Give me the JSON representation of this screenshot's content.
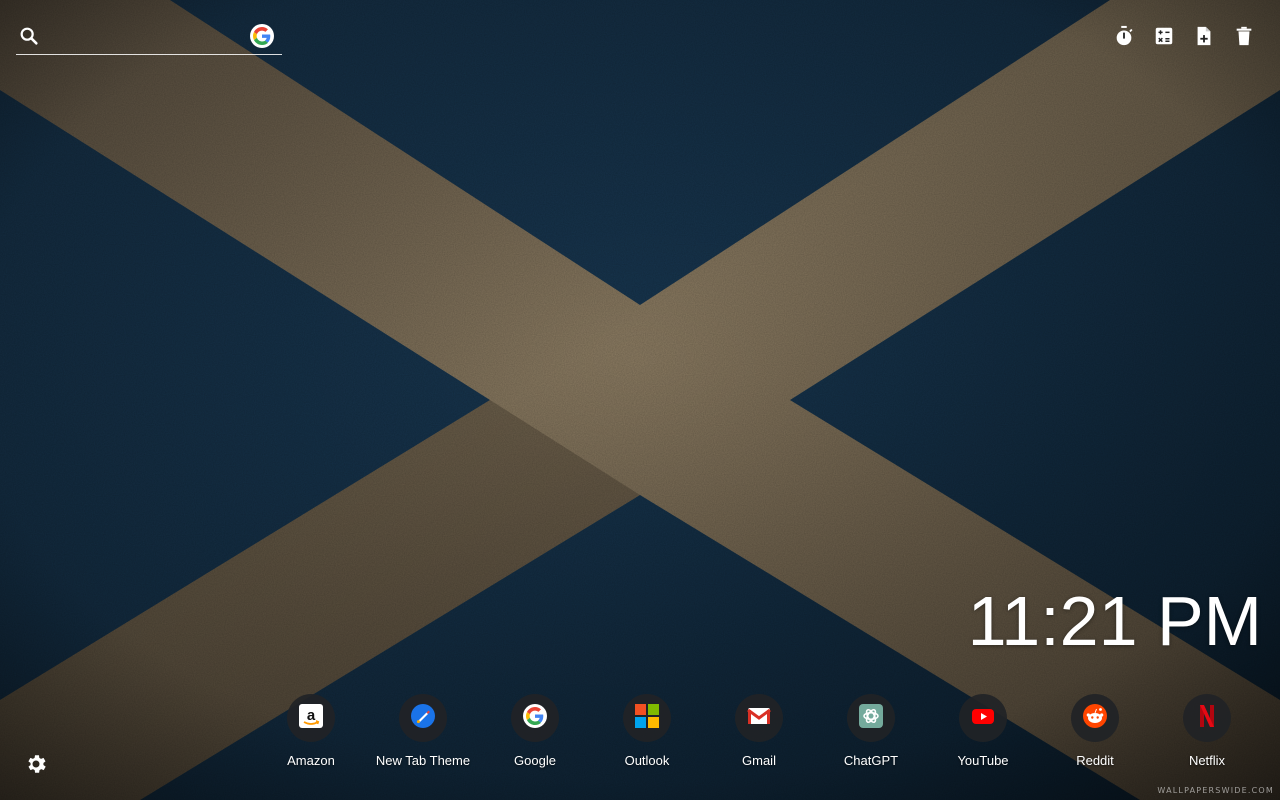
{
  "search": {
    "placeholder": "",
    "value": "",
    "engine_icon": "google-g-icon"
  },
  "toolbar": {
    "items": [
      {
        "name": "timer-button",
        "icon": "stopwatch-icon"
      },
      {
        "name": "calculator-button",
        "icon": "calculator-icon"
      },
      {
        "name": "new-note-button",
        "icon": "note-add-icon"
      },
      {
        "name": "delete-button",
        "icon": "trash-icon"
      }
    ]
  },
  "clock": {
    "time": "11:21 PM"
  },
  "shortcuts": [
    {
      "label": "Amazon",
      "icon": "amazon-icon"
    },
    {
      "label": "New Tab Theme",
      "icon": "new-tab-theme-icon"
    },
    {
      "label": "Google",
      "icon": "google-icon"
    },
    {
      "label": "Outlook",
      "icon": "outlook-icon"
    },
    {
      "label": "Gmail",
      "icon": "gmail-icon"
    },
    {
      "label": "ChatGPT",
      "icon": "chatgpt-icon"
    },
    {
      "label": "YouTube",
      "icon": "youtube-icon"
    },
    {
      "label": "Reddit",
      "icon": "reddit-icon"
    },
    {
      "label": "Netflix",
      "icon": "netflix-icon"
    }
  ],
  "settings": {
    "icon": "gear-icon"
  },
  "watermark": {
    "text": "WALLPAPERSWIDE.COM"
  },
  "colors": {
    "flag_blue": "#16324a",
    "saltire_stone": "#8a7a62",
    "shortcut_bg": "#212326"
  }
}
